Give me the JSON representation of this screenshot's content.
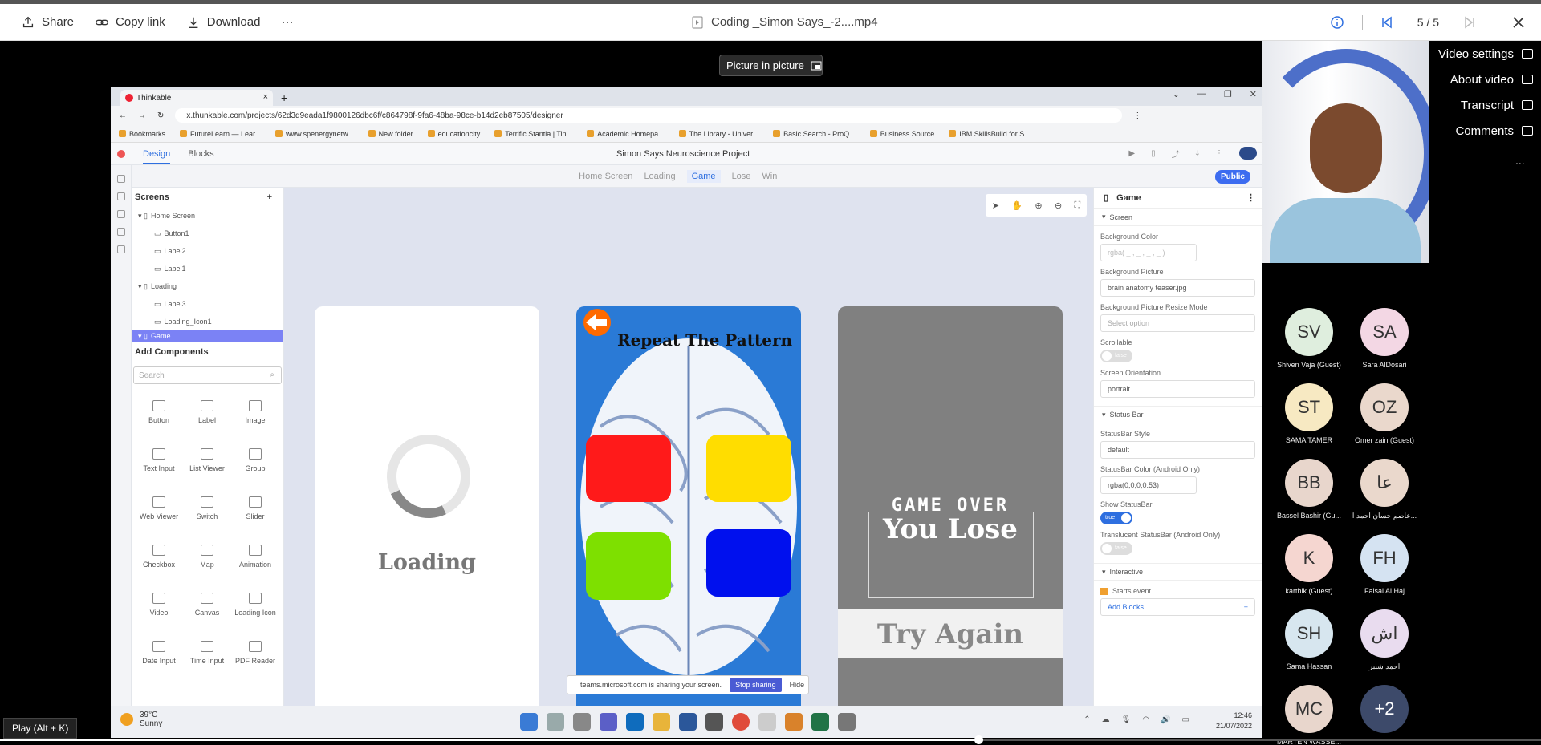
{
  "toolbar": {
    "share_label": "Share",
    "copy_link_label": "Copy link",
    "download_label": "Download",
    "more_label": "···",
    "file_title": "Coding _Simon Says_-2....mp4",
    "info_icon": "info-icon",
    "page_indicator": "5 / 5"
  },
  "player": {
    "pip_label": "Picture in picture",
    "play_hint": "Play (Alt + K)",
    "progress": 0.635
  },
  "browser": {
    "tab_title": "Thinkable",
    "url": "x.thunkable.com/projects/62d3d9eada1f9800126dbc6f/c864798f-9fa6-48ba-98ce-b14d2eb87505/designer",
    "bookmarks": [
      "Bookmarks",
      "FutureLearn — Lear...",
      "www.spenergynetw...",
      "New folder",
      "educationcity",
      "Terrific Stantia | Tin...",
      "Academic Homepa...",
      "The Library - Univer...",
      "Basic Search - ProQ...",
      "Business Source",
      "IBM SkillsBuild for S..."
    ]
  },
  "thunkable": {
    "tab_design": "Design",
    "tab_blocks": "Blocks",
    "project_title": "Simon Says Neuroscience Project",
    "screen_tabs": [
      "Home Screen",
      "Loading",
      "Game",
      "Lose",
      "Win",
      "+"
    ],
    "public_label": "Public",
    "screens_title": "Screens",
    "tree": [
      {
        "label": "Home Screen",
        "indent": 0
      },
      {
        "label": "Button1",
        "indent": 1
      },
      {
        "label": "Label2",
        "indent": 1
      },
      {
        "label": "Label1",
        "indent": 1
      },
      {
        "label": "Loading",
        "indent": 0
      },
      {
        "label": "Label3",
        "indent": 1
      },
      {
        "label": "Loading_Icon1",
        "indent": 1
      },
      {
        "label": "Game",
        "indent": 0
      }
    ],
    "add_components_title": "Add Components",
    "search_placeholder": "Search",
    "components": [
      "Button",
      "Label",
      "Image",
      "Text Input",
      "List Viewer",
      "Group",
      "Web Viewer",
      "Switch",
      "Slider",
      "Checkbox",
      "Map",
      "Animation",
      "Video",
      "Canvas",
      "Loading Icon",
      "Date Input",
      "Time Input",
      "PDF Reader"
    ],
    "phone_loading_text": "Loading",
    "phone_pattern_text": "Repeat The Pattern",
    "pattern_colors": [
      "#ff1a1a",
      "#ffdd00",
      "#7ee000",
      "#0010ee"
    ],
    "phone_game_over": "GAME OVER",
    "phone_you_lose": "You Lose",
    "phone_try_again": "Try Again",
    "props": {
      "title": "Game",
      "section_screen": "Screen",
      "bg_color_label": "Background Color",
      "bg_color_value": "rgba( _ , _ , _ , _ )",
      "bg_picture_label": "Background Picture",
      "bg_picture_value": "brain anatomy teaser.jpg",
      "resize_label": "Background Picture Resize Mode",
      "resize_value": "Select option",
      "scrollable_label": "Scrollable",
      "scrollable_value": "false",
      "orientation_label": "Screen Orientation",
      "orientation_value": "portrait",
      "section_status": "Status Bar",
      "statusbar_style_label": "StatusBar Style",
      "statusbar_style_value": "default",
      "statusbar_color_label": "StatusBar Color (Android Only)",
      "statusbar_color_value": "rgba(0,0,0,0.53)",
      "show_statusbar_label": "Show StatusBar",
      "show_statusbar_value": "true",
      "translucent_label": "Translucent StatusBar (Android Only)",
      "translucent_value": "false",
      "section_interactive": "Interactive",
      "starts_event": "Starts event",
      "add_blocks": "Add Blocks"
    },
    "share_banner_text": "teams.microsoft.com is sharing your screen.",
    "stop_sharing": "Stop sharing",
    "hide": "Hide"
  },
  "taskbar": {
    "temp": "39°C",
    "weather": "Sunny",
    "time": "12:46",
    "date": "21/07/2022"
  },
  "side_menu": {
    "video_settings": "Video settings",
    "about_video": "About video",
    "transcript": "Transcript",
    "comments": "Comments",
    "more": "..."
  },
  "participants": [
    {
      "initials": "SV",
      "name": "Shiven Vaja (Guest)",
      "color": "#dfeede"
    },
    {
      "initials": "SA",
      "name": "Sara AlDosari",
      "color": "#f3d7e4"
    },
    {
      "initials": "ST",
      "name": "SAMA TAMER",
      "color": "#f7e9c2"
    },
    {
      "initials": "OZ",
      "name": "Omer zain (Guest)",
      "color": "#ead8cc"
    },
    {
      "initials": "BB",
      "name": "Bassel Bashir (Gu...",
      "color": "#e8d6cc"
    },
    {
      "initials": "عا",
      "name": "عاصم حسان احمد ا...",
      "color": "#ead8cc"
    },
    {
      "initials": "K",
      "name": "karthik (Guest)",
      "color": "#f5d6d0"
    },
    {
      "initials": "FH",
      "name": "Faisal Al Haj",
      "color": "#d5e3f2"
    },
    {
      "initials": "SH",
      "name": "Sama Hassan",
      "color": "#d7e6ef"
    },
    {
      "initials": "اش",
      "name": "احمد شبير",
      "color": "#e9dcef"
    },
    {
      "initials": "MC",
      "name": "MARTEN WASSE...",
      "color": "#e8d6cc"
    },
    {
      "initials": "+2",
      "name": "",
      "color": "#3d4a6a"
    }
  ]
}
